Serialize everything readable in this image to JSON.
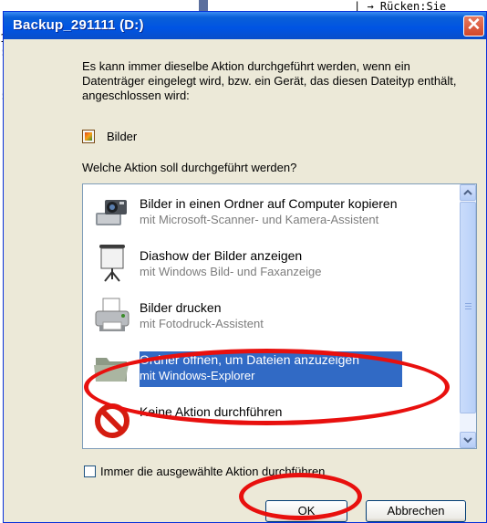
{
  "window": {
    "title": "Backup_291111 (D:)",
    "close_label": "✕"
  },
  "background": {
    "frag_top_right": "| → Rücken:Sie",
    "frag_left_1": "1",
    "frag_left_2": ":",
    "frag_left_3": ":]",
    "frag_left_4": "."
  },
  "intro_text": "Es kann immer dieselbe Aktion durchgeführt werden, wenn ein Datenträger eingelegt wird, bzw. ein Gerät, das diesen Dateityp enthält, angeschlossen wird:",
  "content_type": {
    "icon": "picture-file-icon",
    "label": "Bilder"
  },
  "question": "Welche Aktion soll durchgeführt werden?",
  "actions": [
    {
      "title": "Bilder in einen Ordner auf Computer kopieren",
      "subtitle": "mit Microsoft-Scanner- und Kamera-Assistent",
      "icon": "camera-icon",
      "selected": false
    },
    {
      "title": "Diashow der Bilder anzeigen",
      "subtitle": "mit Windows Bild- und Faxanzeige",
      "icon": "projector-screen-icon",
      "selected": false
    },
    {
      "title": "Bilder drucken",
      "subtitle": "mit Fotodruck-Assistent",
      "icon": "printer-icon",
      "selected": false
    },
    {
      "title": "Ordner öffnen, um Dateien anzuzeigen",
      "subtitle": "mit Windows-Explorer",
      "icon": "folder-icon",
      "selected": true
    },
    {
      "title": "Keine Aktion durchführen",
      "subtitle": "",
      "icon": "no-action-icon",
      "selected": false
    }
  ],
  "always_checkbox": {
    "label": "Immer die ausgewählte Aktion durchführen",
    "checked": false
  },
  "buttons": {
    "ok": "OK",
    "cancel": "Abbrechen"
  },
  "colors": {
    "titlebar": "#0054e3",
    "selection": "#316ac5",
    "annotation": "#e8100e",
    "dialog_bg": "#ece9d8"
  }
}
